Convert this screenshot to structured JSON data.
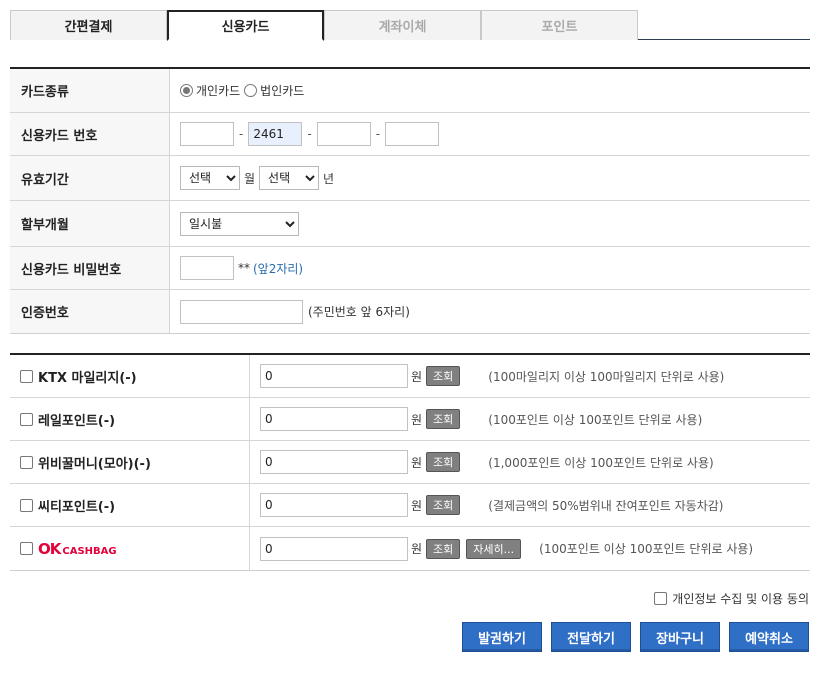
{
  "tabs": [
    "간편결제",
    "신용카드",
    "계좌이체",
    "포인트"
  ],
  "form": {
    "card_type": {
      "label": "카드종류",
      "opt1": "개인카드",
      "opt2": "법인카드"
    },
    "card_number": {
      "label": "신용카드 번호",
      "p1": "",
      "p2": "2461",
      "p3": "",
      "p4": "",
      "sep": "-"
    },
    "expiry": {
      "label": "유효기간",
      "month_select": "선택",
      "month_unit": "월",
      "year_select": "선택",
      "year_unit": "년"
    },
    "installment": {
      "label": "할부개월",
      "value": "일시불"
    },
    "password": {
      "label": "신용카드 비밀번호",
      "stars": "**",
      "hint": "(앞2자리)"
    },
    "auth": {
      "label": "인증번호",
      "hint": "(주민번호 앞 6자리)"
    }
  },
  "points": [
    {
      "label": "KTX 마일리지(-)",
      "value": "0",
      "unit": "원",
      "button": "조회",
      "note": "(100마일리지 이상 100마일리지 단위로 사용)"
    },
    {
      "label": "레일포인트(-)",
      "value": "0",
      "unit": "원",
      "button": "조회",
      "note": "(100포인트 이상 100포인트 단위로 사용)"
    },
    {
      "label": "위비꿀머니(모아)(-)",
      "value": "0",
      "unit": "원",
      "button": "조회",
      "note": "(1,000포인트 이상 100포인트 단위로 사용)"
    },
    {
      "label": "씨티포인트(-)",
      "value": "0",
      "unit": "원",
      "button": "조회",
      "note": "(결제금액의 50%범위내 잔여포인트 자동차감)"
    }
  ],
  "ok_cashbag": {
    "ok": "OK",
    "cashbag": "CASHBAG",
    "value": "0",
    "unit": "원",
    "button": "조회",
    "detail_button": "자세히...",
    "note": "(100포인트 이상 100포인트 단위로 사용)"
  },
  "agree_label": "개인정보 수집 및 이용 동의",
  "actions": [
    "발권하기",
    "전달하기",
    "장바구니",
    "예약취소"
  ]
}
